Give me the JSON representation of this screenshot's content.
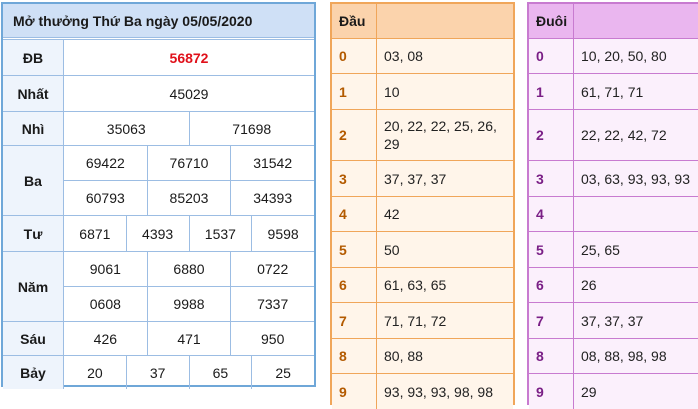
{
  "results": {
    "title": "Mở thưởng Thứ Ba ngày 05/05/2020",
    "special_color": "#e0101a",
    "prizes": [
      {
        "label": "ĐB",
        "lines": [
          [
            "56872"
          ]
        ],
        "special": true
      },
      {
        "label": "Nhất",
        "lines": [
          [
            "45029"
          ]
        ]
      },
      {
        "label": "Nhì",
        "lines": [
          [
            "35063",
            "71698"
          ]
        ]
      },
      {
        "label": "Ba",
        "lines": [
          [
            "69422",
            "76710",
            "31542"
          ],
          [
            "60793",
            "85203",
            "34393"
          ]
        ]
      },
      {
        "label": "Tư",
        "lines": [
          [
            "6871",
            "4393",
            "1537",
            "9598"
          ]
        ]
      },
      {
        "label": "Năm",
        "lines": [
          [
            "9061",
            "6880",
            "0722"
          ],
          [
            "0608",
            "9988",
            "7337"
          ]
        ]
      },
      {
        "label": "Sáu",
        "lines": [
          [
            "426",
            "471",
            "950"
          ]
        ]
      },
      {
        "label": "Bảy",
        "lines": [
          [
            "20",
            "37",
            "65",
            "25"
          ]
        ]
      }
    ]
  },
  "dau": {
    "header": "Đầu",
    "rows": [
      {
        "key": "0",
        "value": "03, 08"
      },
      {
        "key": "1",
        "value": "10"
      },
      {
        "key": "2",
        "value": "20, 22, 22, 25, 26, 29"
      },
      {
        "key": "3",
        "value": "37, 37, 37"
      },
      {
        "key": "4",
        "value": "42"
      },
      {
        "key": "5",
        "value": "50"
      },
      {
        "key": "6",
        "value": "61, 63, 65"
      },
      {
        "key": "7",
        "value": "71, 71, 72"
      },
      {
        "key": "8",
        "value": "80, 88"
      },
      {
        "key": "9",
        "value": "93, 93, 93, 98, 98"
      }
    ]
  },
  "duoi": {
    "header": "Đuôi",
    "rows": [
      {
        "key": "0",
        "value": "10, 20, 50, 80"
      },
      {
        "key": "1",
        "value": "61, 71, 71"
      },
      {
        "key": "2",
        "value": "22, 22, 42, 72"
      },
      {
        "key": "3",
        "value": "03, 63, 93, 93, 93"
      },
      {
        "key": "4",
        "value": ""
      },
      {
        "key": "5",
        "value": "25, 65"
      },
      {
        "key": "6",
        "value": "26"
      },
      {
        "key": "7",
        "value": "37, 37, 37"
      },
      {
        "key": "8",
        "value": "08, 88, 98, 98"
      },
      {
        "key": "9",
        "value": "29"
      }
    ]
  }
}
